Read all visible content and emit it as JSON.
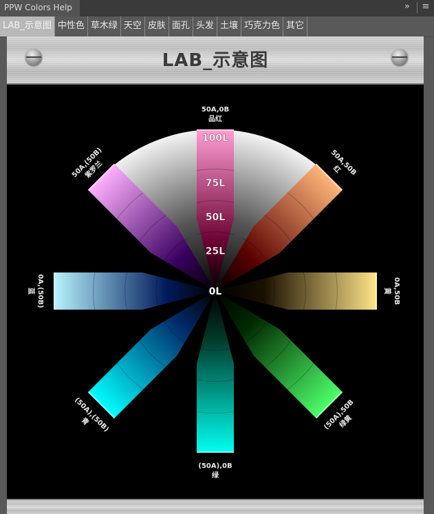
{
  "window": {
    "panel_title": "PPW Colors Help",
    "expand_icon": "double-chevron-right-icon",
    "menu_icon": "hamburger-menu-icon"
  },
  "tabs": [
    {
      "label": "LAB_示意图",
      "active": true
    },
    {
      "label": "中性色",
      "active": false
    },
    {
      "label": "草木绿",
      "active": false
    },
    {
      "label": "天空",
      "active": false
    },
    {
      "label": "皮肤",
      "active": false
    },
    {
      "label": "面孔",
      "active": false
    },
    {
      "label": "头发",
      "active": false
    },
    {
      "label": "土壤",
      "active": false
    },
    {
      "label": "巧克力色",
      "active": false
    },
    {
      "label": "其它",
      "active": false
    }
  ],
  "header": {
    "title": "LAB_示意图"
  },
  "diagram": {
    "center_label": "0L",
    "lightness_labels": [
      "25L",
      "50L",
      "75L",
      "100L"
    ],
    "arms": [
      {
        "id": "magenta",
        "ab": "50A,0B",
        "name": "品红",
        "direction": "up",
        "light_color": "#ff9ed4",
        "dark_color": "#6a0030"
      },
      {
        "id": "red",
        "ab": "50A,50B",
        "name": "红",
        "direction": "up-right",
        "light_color": "#ffb77a",
        "dark_color": "#5a0000"
      },
      {
        "id": "yellow",
        "ab": "0A,50B",
        "name": "黄",
        "direction": "right",
        "light_color": "#ffe58a",
        "dark_color": "#1a1000"
      },
      {
        "id": "yellow-green",
        "ab": "(50A),50B",
        "name": "绿黄",
        "direction": "down-right",
        "light_color": "#4dff6a",
        "dark_color": "#002a00"
      },
      {
        "id": "green",
        "ab": "(50A),0B",
        "name": "绿",
        "direction": "down",
        "light_color": "#00fff0",
        "dark_color": "#003a2a"
      },
      {
        "id": "cyan",
        "ab": "(50A),(50B)",
        "name": "青",
        "direction": "down-left",
        "light_color": "#00ffff",
        "dark_color": "#002a6a"
      },
      {
        "id": "blue",
        "ab": "0A,(50B)",
        "name": "蓝",
        "direction": "left",
        "light_color": "#b8f4ff",
        "dark_color": "#001a5a"
      },
      {
        "id": "violet",
        "ab": "50A,(50B)",
        "name": "紫罗兰",
        "direction": "up-left",
        "light_color": "#ffb0ff",
        "dark_color": "#3a0060"
      }
    ]
  }
}
